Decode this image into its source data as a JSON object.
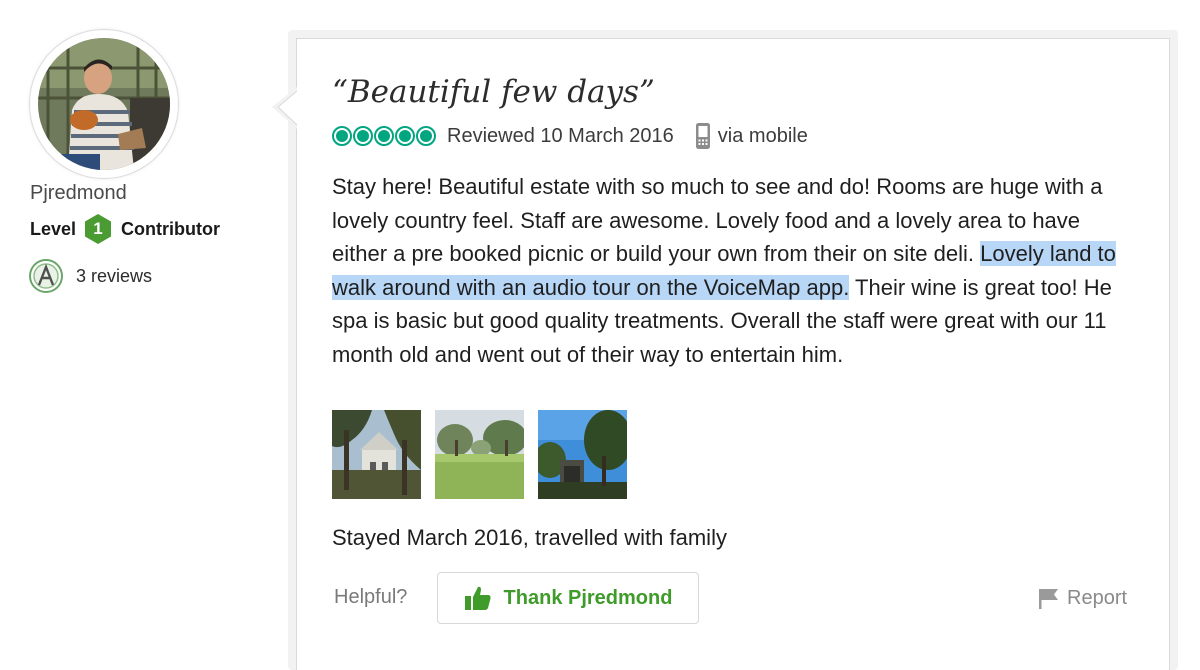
{
  "member": {
    "username": "Pjredmond",
    "level_prefix": "Level",
    "level_number": "1",
    "level_suffix": "Contributor",
    "reviews_count": "3 reviews",
    "badge_color": "#4a9b32"
  },
  "review": {
    "title": "“Beautiful few days”",
    "rating_bubbles": 5,
    "rating_color": "#00a680",
    "reviewed_date": "Reviewed 10 March 2016",
    "via": "via mobile",
    "text_part1": "Stay here! Beautiful estate with so much to see and do! Rooms are huge with a lovely country feel. Staff are awesome. Lovely food and a lovely area to have either a pre booked picnic or build your own from their on site deli. ",
    "text_highlighted": "Lovely land to walk around with an audio tour on the VoiceMap app.",
    "text_part2": " Their wine is great too! He spa is basic but good quality treatments. Overall the staff were great with our 11 month old and went out of their way to entertain him.",
    "highlight_color": "#b8d7f7",
    "photos": [
      "estate-building-photo",
      "lawn-garden-photo",
      "trees-gate-photo"
    ],
    "stayed": "Stayed March 2016, travelled with family"
  },
  "actions": {
    "helpful_label": "Helpful?",
    "thank_label": "Thank Pjredmond",
    "thank_color": "#3f9b2a",
    "report_label": "Report"
  }
}
